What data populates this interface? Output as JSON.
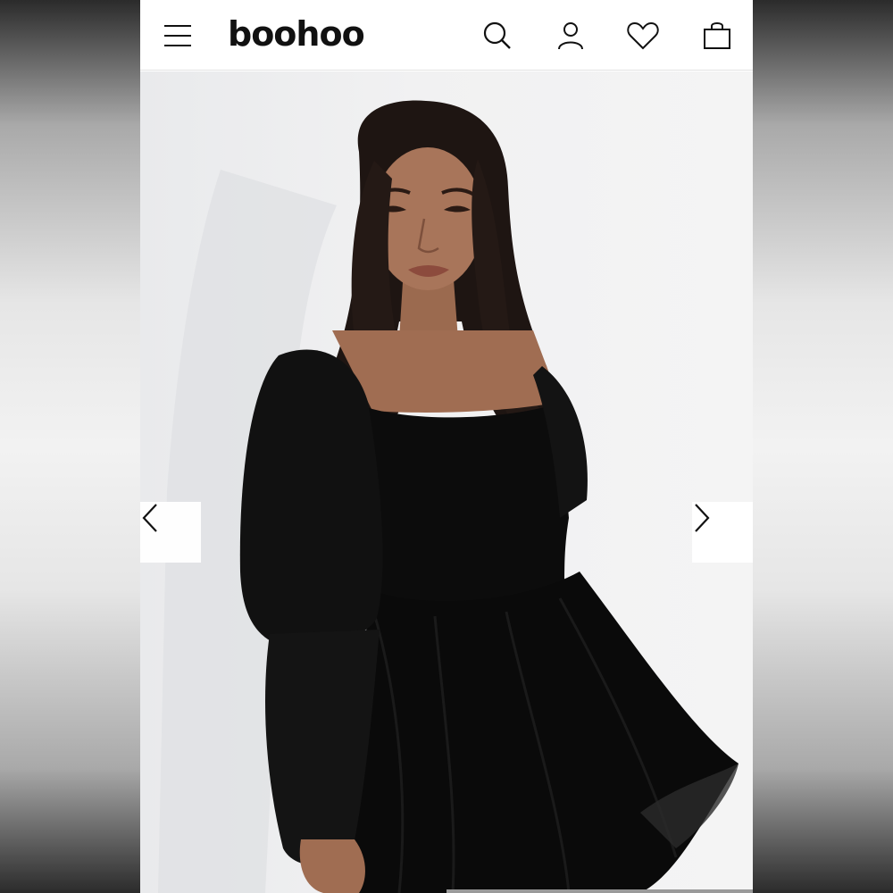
{
  "header": {
    "brand": "boohoo",
    "icons": [
      "menu-icon",
      "search-icon",
      "account-icon",
      "wishlist-icon",
      "bag-icon"
    ]
  },
  "gallery": {
    "previous_icon": "chevron-left-icon",
    "next_icon": "chevron-right-icon",
    "progress": 0.5
  },
  "colors": {
    "text": "#111111",
    "header_bg": "#ffffff",
    "garment": "#0c0c0c",
    "backdrop": "#f1f1f2"
  }
}
